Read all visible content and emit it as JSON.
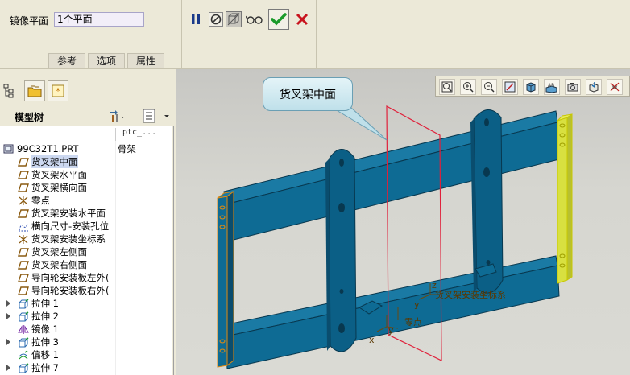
{
  "dashboard": {
    "mirror_plane_label": "镜像平面",
    "mirror_plane_value": "1个平面",
    "tabs": [
      "参考",
      "选项",
      "属性"
    ],
    "buttons": [
      "pause",
      "no-preview",
      "geometry-preview",
      "glasses",
      "apply",
      "cancel"
    ]
  },
  "left_panel": {
    "tree_title": "模型树",
    "column_header": "ptc_...",
    "rows": [
      {
        "label": "99C32T1.PRT",
        "value": "骨架",
        "icon": "part-icon",
        "expandable": false
      },
      {
        "label": "货叉架中面",
        "icon": "datum-plane-icon",
        "selected": true
      },
      {
        "label": "货叉架水平面",
        "icon": "datum-plane-icon"
      },
      {
        "label": "货叉架横向面",
        "icon": "datum-plane-icon"
      },
      {
        "label": "零点",
        "icon": "csys-icon"
      },
      {
        "label": "货叉架安装水平面",
        "icon": "datum-plane-icon"
      },
      {
        "label": "横向尺寸-安装孔位",
        "icon": "sketch-icon"
      },
      {
        "label": "货叉架安装坐标系",
        "icon": "csys-icon"
      },
      {
        "label": "货叉架左侧面",
        "icon": "datum-plane-icon"
      },
      {
        "label": "货叉架右侧面",
        "icon": "datum-plane-icon"
      },
      {
        "label": "导向轮安装板左外(",
        "icon": "datum-plane-icon"
      },
      {
        "label": "导向轮安装板右外(",
        "icon": "datum-plane-icon"
      },
      {
        "label": "拉伸 1",
        "icon": "extrude-icon",
        "expandable": true
      },
      {
        "label": "拉伸 2",
        "icon": "extrude-icon",
        "expandable": true
      },
      {
        "label": "镜像 1",
        "icon": "mirror-icon"
      },
      {
        "label": "拉伸 3",
        "icon": "extrude-icon",
        "expandable": true
      },
      {
        "label": "偏移 1",
        "icon": "offset-icon"
      },
      {
        "label": "拉伸 7",
        "icon": "extrude-icon",
        "expandable": true
      }
    ]
  },
  "viewport": {
    "callout_text": "货叉架中面",
    "labels": {
      "csys": "货叉架安装坐标系",
      "zero": "零点",
      "axis_x": "x",
      "axis_y": "y",
      "axis_z": "z",
      "axis_y2": "y"
    }
  },
  "colors": {
    "model": "#0e6b94",
    "model_dark": "#0a4d6e",
    "datum_plane": "#e0203a",
    "highlight": "#e8e820",
    "outline_orange": "#e08a10"
  }
}
